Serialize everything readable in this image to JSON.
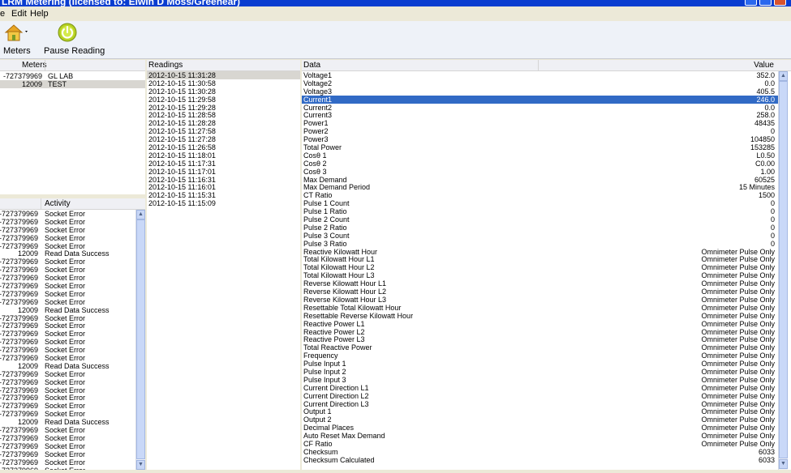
{
  "window": {
    "title": "LRM Metering (licensed to: Elwin D Moss/Greenear)"
  },
  "menu": [
    "e",
    "Edit",
    "Help"
  ],
  "toolbar": {
    "meters_label": "Meters",
    "pause_label": "Pause Reading"
  },
  "meters": {
    "headers": [
      "Meters",
      ""
    ],
    "rows": [
      {
        "id": "-727379969",
        "name": "GL LAB"
      },
      {
        "id": "12009",
        "name": "TEST"
      }
    ]
  },
  "activity": {
    "headers": [
      "",
      "Activity"
    ],
    "rows": [
      {
        "id": "-727379969",
        "msg": "Socket Error"
      },
      {
        "id": "-727379969",
        "msg": "Socket Error"
      },
      {
        "id": "-727379969",
        "msg": "Socket Error"
      },
      {
        "id": "-727379969",
        "msg": "Socket Error"
      },
      {
        "id": "-727379969",
        "msg": "Socket Error"
      },
      {
        "id": "12009",
        "msg": "Read Data Success"
      },
      {
        "id": "-727379969",
        "msg": "Socket Error"
      },
      {
        "id": "-727379969",
        "msg": "Socket Error"
      },
      {
        "id": "-727379969",
        "msg": "Socket Error"
      },
      {
        "id": "-727379969",
        "msg": "Socket Error"
      },
      {
        "id": "-727379969",
        "msg": "Socket Error"
      },
      {
        "id": "-727379969",
        "msg": "Socket Error"
      },
      {
        "id": "12009",
        "msg": "Read Data Success"
      },
      {
        "id": "-727379969",
        "msg": "Socket Error"
      },
      {
        "id": "-727379969",
        "msg": "Socket Error"
      },
      {
        "id": "-727379969",
        "msg": "Socket Error"
      },
      {
        "id": "-727379969",
        "msg": "Socket Error"
      },
      {
        "id": "-727379969",
        "msg": "Socket Error"
      },
      {
        "id": "-727379969",
        "msg": "Socket Error"
      },
      {
        "id": "12009",
        "msg": "Read Data Success"
      },
      {
        "id": "-727379969",
        "msg": "Socket Error"
      },
      {
        "id": "-727379969",
        "msg": "Socket Error"
      },
      {
        "id": "-727379969",
        "msg": "Socket Error"
      },
      {
        "id": "-727379969",
        "msg": "Socket Error"
      },
      {
        "id": "-727379969",
        "msg": "Socket Error"
      },
      {
        "id": "-727379969",
        "msg": "Socket Error"
      },
      {
        "id": "12009",
        "msg": "Read Data Success"
      },
      {
        "id": "-727379969",
        "msg": "Socket Error"
      },
      {
        "id": "-727379969",
        "msg": "Socket Error"
      },
      {
        "id": "-727379969",
        "msg": "Socket Error"
      },
      {
        "id": "-727379969",
        "msg": "Socket Error"
      },
      {
        "id": "-727379969",
        "msg": "Socket Error"
      },
      {
        "id": "-727379969",
        "msg": "Socket Error"
      }
    ]
  },
  "readings": {
    "header": "Readings",
    "rows": [
      "2012-10-15 11:31:28",
      "2012-10-15 11:30:58",
      "2012-10-15 11:30:28",
      "2012-10-15 11:29:58",
      "2012-10-15 11:29:28",
      "2012-10-15 11:28:58",
      "2012-10-15 11:28:28",
      "2012-10-15 11:27:58",
      "2012-10-15 11:27:28",
      "2012-10-15 11:26:58",
      "2012-10-15 11:18:01",
      "2012-10-15 11:17:31",
      "2012-10-15 11:17:01",
      "2012-10-15 11:16:31",
      "2012-10-15 11:16:01",
      "2012-10-15 11:15:31",
      "2012-10-15 11:15:09"
    ]
  },
  "data": {
    "headers": [
      "Data",
      "Value"
    ],
    "rows": [
      {
        "name": "Voltage1",
        "value": "352.0"
      },
      {
        "name": "Voltage2",
        "value": "0.0"
      },
      {
        "name": "Voltage3",
        "value": "405.5"
      },
      {
        "name": "Current1",
        "value": "246.0"
      },
      {
        "name": "Current2",
        "value": "0.0"
      },
      {
        "name": "Current3",
        "value": "258.0"
      },
      {
        "name": "Power1",
        "value": "48435"
      },
      {
        "name": "Power2",
        "value": "0"
      },
      {
        "name": "Power3",
        "value": "104850"
      },
      {
        "name": "Total Power",
        "value": "153285"
      },
      {
        "name": "Cosθ 1",
        "value": "L0.50"
      },
      {
        "name": "Cosθ 2",
        "value": "C0.00"
      },
      {
        "name": "Cosθ 3",
        "value": "1.00"
      },
      {
        "name": "Max Demand",
        "value": "60525"
      },
      {
        "name": "Max Demand Period",
        "value": "15 Minutes"
      },
      {
        "name": "CT Ratio",
        "value": "1500"
      },
      {
        "name": "Pulse 1 Count",
        "value": "0"
      },
      {
        "name": "Pulse 1 Ratio",
        "value": "0"
      },
      {
        "name": "Pulse 2 Count",
        "value": "0"
      },
      {
        "name": "Pulse 2 Ratio",
        "value": "0"
      },
      {
        "name": "Pulse 3 Count",
        "value": "0"
      },
      {
        "name": "Pulse 3 Ratio",
        "value": "0"
      },
      {
        "name": "Reactive Kilowatt Hour",
        "value": "Omnimeter Pulse Only"
      },
      {
        "name": "Total Kilowatt Hour L1",
        "value": "Omnimeter Pulse Only"
      },
      {
        "name": "Total Kilowatt Hour L2",
        "value": "Omnimeter Pulse Only"
      },
      {
        "name": "Total Kilowatt Hour L3",
        "value": "Omnimeter Pulse Only"
      },
      {
        "name": "Reverse Kilowatt Hour L1",
        "value": "Omnimeter Pulse Only"
      },
      {
        "name": "Reverse Kilowatt Hour L2",
        "value": "Omnimeter Pulse Only"
      },
      {
        "name": "Reverse Kilowatt Hour L3",
        "value": "Omnimeter Pulse Only"
      },
      {
        "name": "Resettable Total Kilowatt Hour",
        "value": "Omnimeter Pulse Only"
      },
      {
        "name": "Resettable Reverse Kilowatt Hour",
        "value": "Omnimeter Pulse Only"
      },
      {
        "name": "Reactive Power L1",
        "value": "Omnimeter Pulse Only"
      },
      {
        "name": "Reactive Power L2",
        "value": "Omnimeter Pulse Only"
      },
      {
        "name": "Reactive Power L3",
        "value": "Omnimeter Pulse Only"
      },
      {
        "name": "Total Reactive Power",
        "value": "Omnimeter Pulse Only"
      },
      {
        "name": "Frequency",
        "value": "Omnimeter Pulse Only"
      },
      {
        "name": "Pulse Input 1",
        "value": "Omnimeter Pulse Only"
      },
      {
        "name": "Pulse Input 2",
        "value": "Omnimeter Pulse Only"
      },
      {
        "name": "Pulse Input 3",
        "value": "Omnimeter Pulse Only"
      },
      {
        "name": "Current Direction L1",
        "value": "Omnimeter Pulse Only"
      },
      {
        "name": "Current Direction L2",
        "value": "Omnimeter Pulse Only"
      },
      {
        "name": "Current Direction L3",
        "value": "Omnimeter Pulse Only"
      },
      {
        "name": "Output 1",
        "value": "Omnimeter Pulse Only"
      },
      {
        "name": "Output 2",
        "value": "Omnimeter Pulse Only"
      },
      {
        "name": "Decimal Places",
        "value": "Omnimeter Pulse Only"
      },
      {
        "name": "Auto Reset Max Demand",
        "value": "Omnimeter Pulse Only"
      },
      {
        "name": "CF Ratio",
        "value": "Omnimeter Pulse Only"
      },
      {
        "name": "Checksum",
        "value": "6033"
      },
      {
        "name": "Checksum Calculated",
        "value": "6033"
      }
    ]
  },
  "colors": {
    "titlebar": "#0a3dd0",
    "selection": "#316ac5",
    "inactive_selection": "#d8d6d1",
    "toolbar_bg": "#eef2f8"
  },
  "icons": {
    "meters": "house-icon",
    "pause": "power-icon"
  }
}
